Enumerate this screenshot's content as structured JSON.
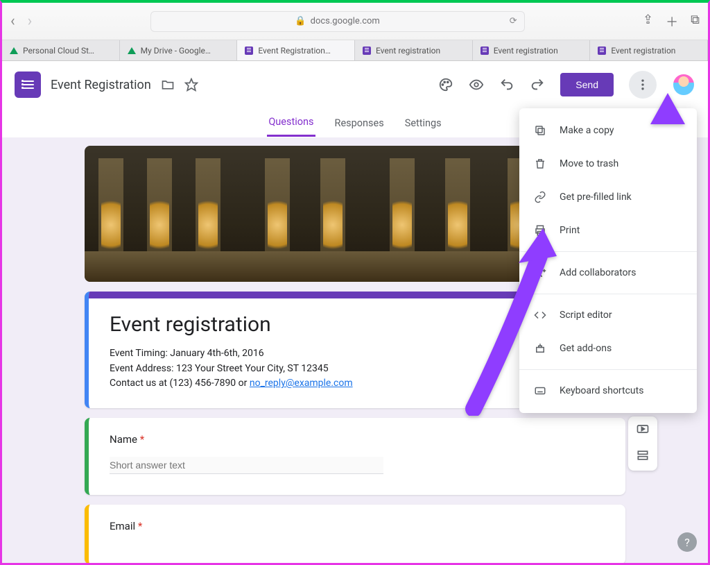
{
  "browser": {
    "domain": "docs.google.com",
    "tabs": [
      {
        "label": "Personal Cloud St…",
        "icon": "drive"
      },
      {
        "label": "My Drive - Google…",
        "icon": "drive"
      },
      {
        "label": "Event Registration…",
        "icon": "forms",
        "active": true
      },
      {
        "label": "Event registration",
        "icon": "forms"
      },
      {
        "label": "Event registration",
        "icon": "forms"
      },
      {
        "label": "Event registration",
        "icon": "forms"
      }
    ]
  },
  "header": {
    "doc_title": "Event Registration",
    "send_label": "Send"
  },
  "subnav": {
    "questions": "Questions",
    "responses": "Responses",
    "settings": "Settings"
  },
  "form": {
    "title": "Event registration",
    "desc_line1": "Event Timing: January 4th-6th, 2016",
    "desc_line2": "Event Address: 123 Your Street Your City, ST 12345",
    "desc_line3_prefix": "Contact us at (123) 456-7890 or ",
    "desc_email": "no_reply@example.com",
    "q1_label": "Name",
    "q1_placeholder": "Short answer text",
    "q2_label": "Email"
  },
  "menu": {
    "copy": "Make a copy",
    "trash": "Move to trash",
    "prefill": "Get pre-filled link",
    "print": "Print",
    "collab": "Add collaborators",
    "script": "Script editor",
    "addons": "Get add-ons",
    "shortcuts": "Keyboard shortcuts"
  }
}
